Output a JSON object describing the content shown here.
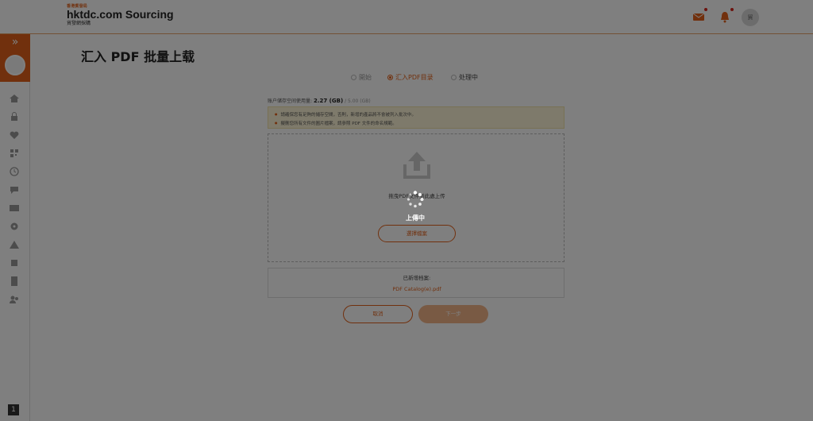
{
  "header": {
    "brand_small": "香港貿發局",
    "brand_main": "hktdc.com Sourcing",
    "brand_sub": "貿發網採購",
    "avatar_text": "貿",
    "icons": [
      "mail-icon",
      "bell-icon"
    ]
  },
  "sidebar": {
    "expand_label": "»",
    "bottom_label": "1",
    "icons": [
      "home-icon",
      "lock-icon",
      "heart-icon",
      "qr-icon",
      "history-icon",
      "chat-icon",
      "mail-icon",
      "gear-icon",
      "warning-icon",
      "box-icon",
      "document-icon",
      "users-icon"
    ]
  },
  "page": {
    "title": "汇入 PDF 批量上载"
  },
  "steps": [
    {
      "label": "開始"
    },
    {
      "label": "汇入PDF目录"
    },
    {
      "label": "处理中"
    }
  ],
  "storage": {
    "label": "账户储存空间使用量:",
    "used": "2.27 (GB)",
    "total": "/ 5.00 (GB)"
  },
  "notice": {
    "items": [
      "請確保您有足夠的儲存空間，否則，新增的產品將不會被列入批次中。",
      "擬刪您所有文件的圖片檔案，請參照 PDF 文件的命名規範。"
    ]
  },
  "dropzone": {
    "text": "拖曳PDF文件到此處上传",
    "button": "選擇檔案"
  },
  "added": {
    "label": "已新增档案:",
    "file": "PDF Catalog(e).pdf"
  },
  "actions": {
    "cancel": "取消",
    "next": "下一步"
  },
  "overlay": {
    "loading_text": "上傳中"
  },
  "colors": {
    "accent": "#e2611a",
    "notice_bg": "#fdf5d6",
    "overlay": "rgba(0,0,0,0.5)"
  }
}
